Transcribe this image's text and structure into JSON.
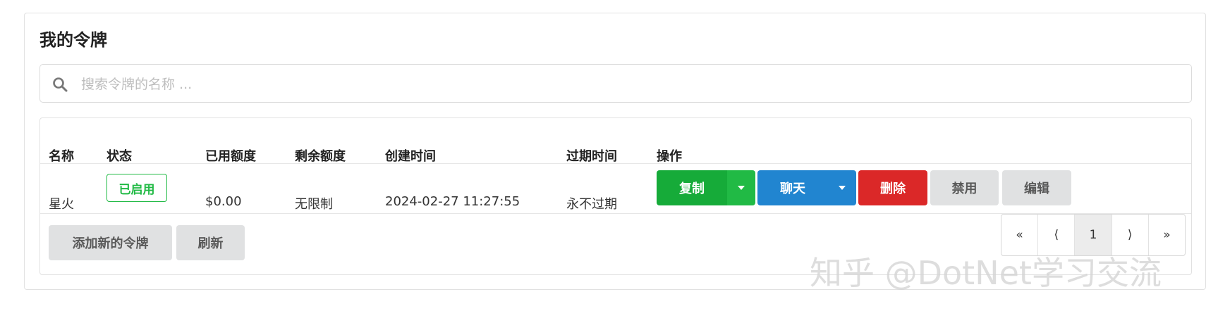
{
  "card": {
    "title": "我的令牌"
  },
  "search": {
    "placeholder": "搜索令牌的名称 ...",
    "value": ""
  },
  "table": {
    "headers": {
      "name": "名称",
      "status": "状态",
      "used": "已用额度",
      "remaining": "剩余额度",
      "created": "创建时间",
      "expires": "过期时间",
      "actions": "操作"
    },
    "rows": [
      {
        "name": "星火",
        "status": "已启用",
        "used": "$0.00",
        "remaining": "无限制",
        "created": "2024-02-27 11:27:55",
        "expires": "永不过期",
        "actions": {
          "copy": "复制",
          "chat": "聊天",
          "delete": "删除",
          "disable": "禁用",
          "edit": "编辑"
        }
      }
    ]
  },
  "bottom": {
    "add_label": "添加新的令牌",
    "refresh_label": "刷新"
  },
  "pager": {
    "first": "«",
    "prev": "⟨",
    "current": "1",
    "next": "⟩",
    "last": "»"
  },
  "watermark": "知乎 @DotNet学习交流",
  "colors": {
    "green": "#21ba45",
    "blue": "#2185d0",
    "red": "#db2828",
    "grey": "#e0e1e2"
  },
  "icons": {
    "search": "search-icon",
    "dropdown": "caret-down-icon"
  }
}
